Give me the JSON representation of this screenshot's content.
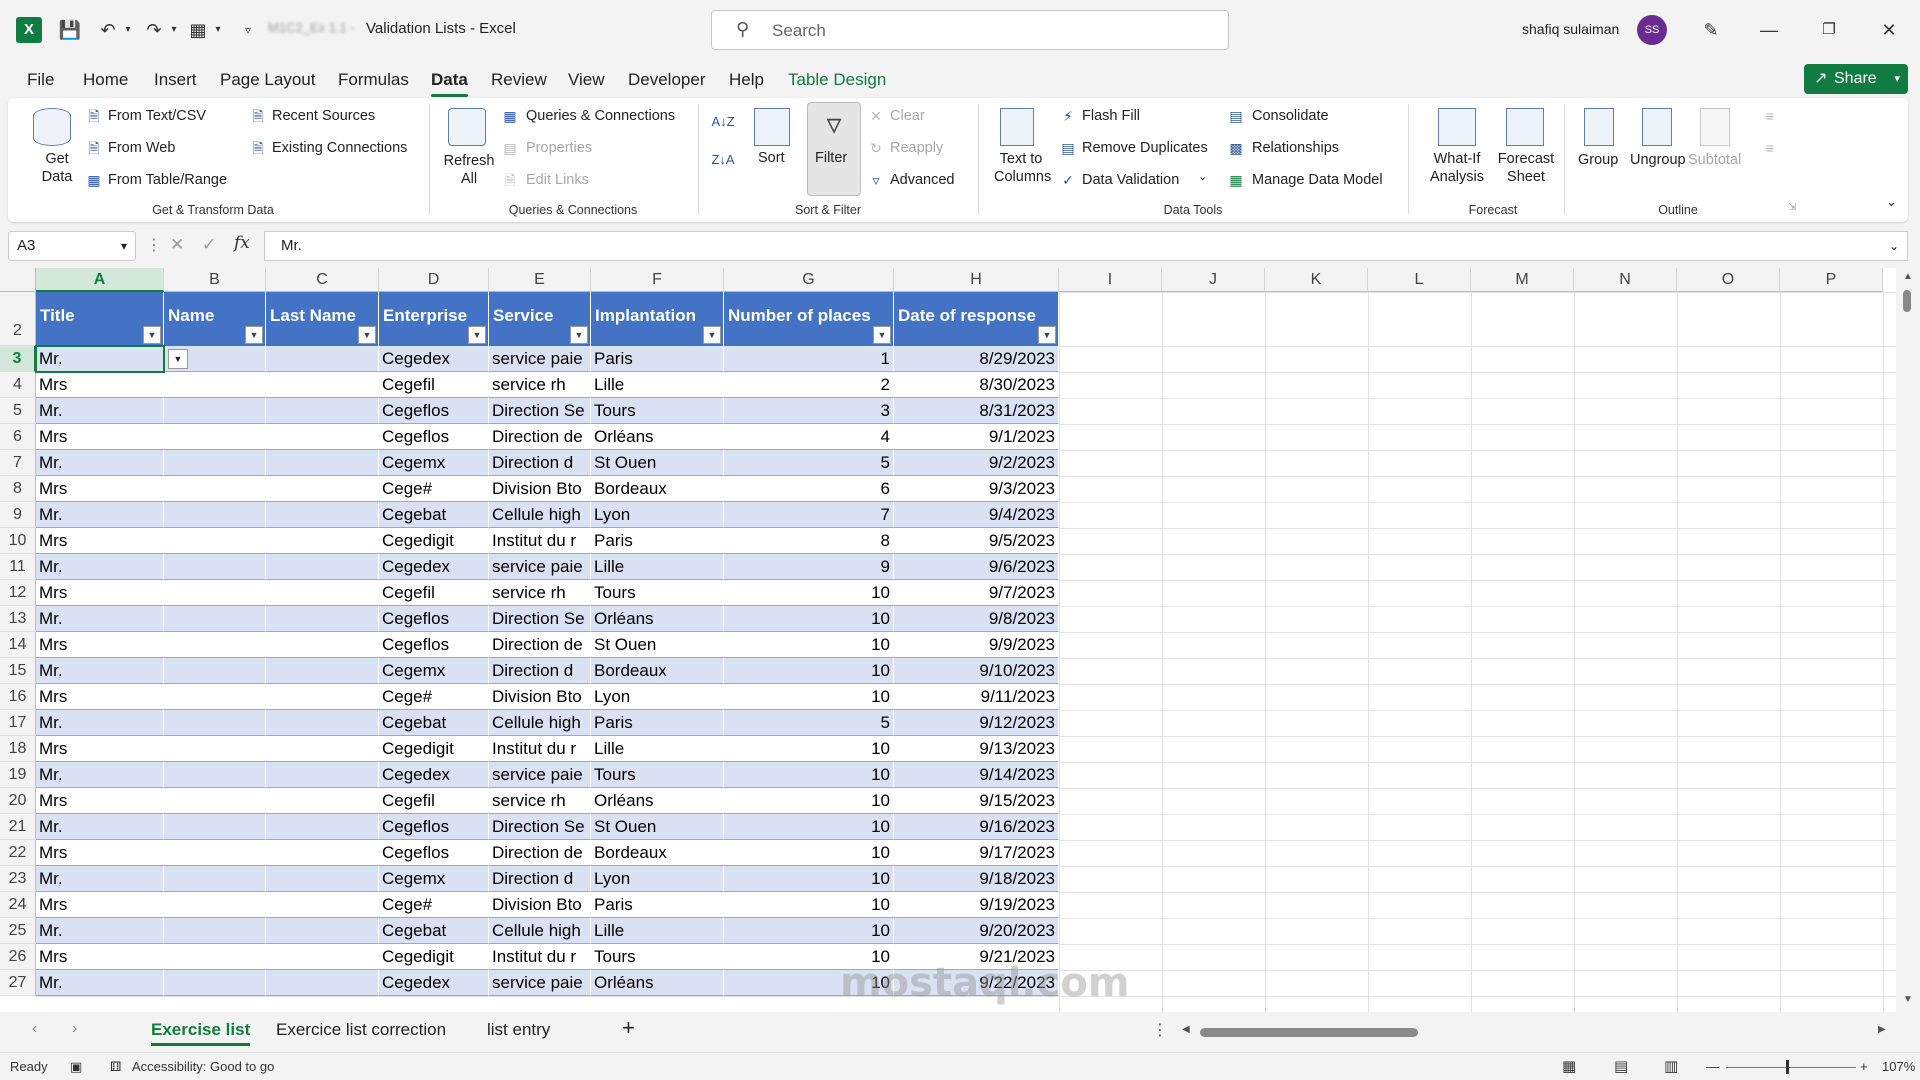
{
  "titlebar": {
    "app_icon": "excel-logo-icon",
    "filename_blurred": "M1C2_Ex 1.1 -",
    "doc_title": "Validation Lists  -  Excel",
    "search_placeholder": "Search",
    "user_name": "shafiq sulaiman",
    "user_initials": "SS"
  },
  "menu": {
    "tabs": [
      "File",
      "Home",
      "Insert",
      "Page Layout",
      "Formulas",
      "Data",
      "Review",
      "View",
      "Developer",
      "Help",
      "Table Design"
    ],
    "active": "Data",
    "share_label": "Share"
  },
  "ribbon": {
    "get_data": "Get Data",
    "from_text_csv": "From Text/CSV",
    "from_web": "From Web",
    "from_table_range": "From Table/Range",
    "recent_sources": "Recent Sources",
    "existing_connections": "Existing Connections",
    "group_get_transform": "Get & Transform Data",
    "refresh_all": "Refresh All",
    "queries_connections": "Queries & Connections",
    "properties": "Properties",
    "edit_links": "Edit Links",
    "group_queries": "Queries & Connections",
    "sort": "Sort",
    "filter": "Filter",
    "clear": "Clear",
    "reapply": "Reapply",
    "advanced": "Advanced",
    "group_sort_filter": "Sort & Filter",
    "text_to_columns": "Text to Columns",
    "flash_fill": "Flash Fill",
    "remove_duplicates": "Remove Duplicates",
    "data_validation": "Data Validation",
    "consolidate": "Consolidate",
    "relationships": "Relationships",
    "manage_data_model": "Manage Data Model",
    "group_data_tools": "Data Tools",
    "what_if": "What-If Analysis",
    "forecast_sheet": "Forecast Sheet",
    "group_forecast": "Forecast",
    "group": "Group",
    "ungroup": "Ungroup",
    "subtotal": "Subtotal",
    "group_outline": "Outline"
  },
  "formula_bar": {
    "name_box": "A3",
    "fx": "fx",
    "formula": "Mr."
  },
  "grid": {
    "columns": [
      "A",
      "B",
      "C",
      "D",
      "E",
      "F",
      "G",
      "H",
      "I",
      "J",
      "K",
      "L",
      "M",
      "N",
      "O",
      "P"
    ],
    "row_numbers": [
      "2",
      "3",
      "4",
      "5",
      "6",
      "7",
      "8",
      "9",
      "10",
      "11",
      "12",
      "13",
      "14",
      "15",
      "16",
      "17",
      "18",
      "19",
      "20",
      "21",
      "22",
      "23",
      "24",
      "25",
      "26",
      "27"
    ],
    "headers": [
      "Title",
      "Name",
      "Last Name",
      "Enterprise",
      "Service",
      "Implantation",
      "Number of places",
      "Date of response"
    ],
    "rows": [
      [
        "Mr.",
        "",
        "",
        "Cegedex",
        " service paie",
        "Paris",
        "1",
        "8/29/2023"
      ],
      [
        "Mrs",
        "",
        "",
        "Cegefil",
        " service rh",
        "Lille",
        "2",
        "8/30/2023"
      ],
      [
        "Mr.",
        "",
        "",
        "Cegeflos",
        "Direction Se",
        "Tours",
        "3",
        "8/31/2023"
      ],
      [
        "Mrs",
        "",
        "",
        "Cegeflos",
        "Direction de",
        "Orléans",
        "4",
        "9/1/2023"
      ],
      [
        "Mr.",
        "",
        "",
        "Cegemx",
        " Direction d",
        "St Ouen",
        "5",
        "9/2/2023"
      ],
      [
        "Mrs",
        "",
        "",
        "Cege#",
        "Division Bto",
        "Bordeaux",
        "6",
        "9/3/2023"
      ],
      [
        "Mr.",
        "",
        "",
        "Cegebat",
        "Cellule high",
        "Lyon",
        "7",
        "9/4/2023"
      ],
      [
        "Mrs",
        "",
        "",
        "Cegedigit",
        "Institut du r",
        "Paris",
        "8",
        "9/5/2023"
      ],
      [
        "Mr.",
        "",
        "",
        "Cegedex",
        " service paie",
        "Lille",
        "9",
        "9/6/2023"
      ],
      [
        "Mrs",
        "",
        "",
        "Cegefil",
        " service rh",
        "Tours",
        "10",
        "9/7/2023"
      ],
      [
        "Mr.",
        "",
        "",
        "Cegeflos",
        "Direction Se",
        "Orléans",
        "10",
        "9/8/2023"
      ],
      [
        "Mrs",
        "",
        "",
        "Cegeflos",
        "Direction de",
        "St Ouen",
        "10",
        "9/9/2023"
      ],
      [
        "Mr.",
        "",
        "",
        "Cegemx",
        " Direction d",
        "Bordeaux",
        "10",
        "9/10/2023"
      ],
      [
        "Mrs",
        "",
        "",
        "Cege#",
        "Division Bto",
        "Lyon",
        "10",
        "9/11/2023"
      ],
      [
        "Mr.",
        "",
        "",
        "Cegebat",
        "Cellule high",
        "Paris",
        "5",
        "9/12/2023"
      ],
      [
        "Mrs",
        "",
        "",
        "Cegedigit",
        "Institut du r",
        "Lille",
        "10",
        "9/13/2023"
      ],
      [
        "Mr.",
        "",
        "",
        "Cegedex",
        " service paie",
        "Tours",
        "10",
        "9/14/2023"
      ],
      [
        "Mrs",
        "",
        "",
        "Cegefil",
        " service rh",
        "Orléans",
        "10",
        "9/15/2023"
      ],
      [
        "Mr.",
        "",
        "",
        "Cegeflos",
        "Direction Se",
        "St Ouen",
        "10",
        "9/16/2023"
      ],
      [
        "Mrs",
        "",
        "",
        "Cegeflos",
        "Direction de",
        "Bordeaux",
        "10",
        "9/17/2023"
      ],
      [
        "Mr.",
        "",
        "",
        "Cegemx",
        " Direction d",
        "Lyon",
        "10",
        "9/18/2023"
      ],
      [
        "Mrs",
        "",
        "",
        "Cege#",
        "Division Bto",
        "Paris",
        "10",
        "9/19/2023"
      ],
      [
        "Mr.",
        "",
        "",
        "Cegebat",
        "Cellule high",
        "Lille",
        "10",
        "9/20/2023"
      ],
      [
        "Mrs",
        "",
        "",
        "Cegedigit",
        "Institut du r",
        "Tours",
        "10",
        "9/21/2023"
      ],
      [
        "Mr.",
        "",
        "",
        "Cegedex",
        " service paie",
        "Orléans",
        "10",
        "9/22/2023"
      ]
    ]
  },
  "sheets": {
    "tabs": [
      "Exercise list",
      "Exercice list correction",
      "list entry"
    ],
    "active": "Exercise list",
    "add_label": "+"
  },
  "status": {
    "ready": "Ready",
    "accessibility": "Accessibility: Good to go",
    "zoom": "107%"
  },
  "watermark": "mostaql.com",
  "colors": {
    "accent": "#107c41",
    "table_header": "#4472c4",
    "band_row": "#d9e1f2",
    "avatar": "#6b2c91"
  }
}
